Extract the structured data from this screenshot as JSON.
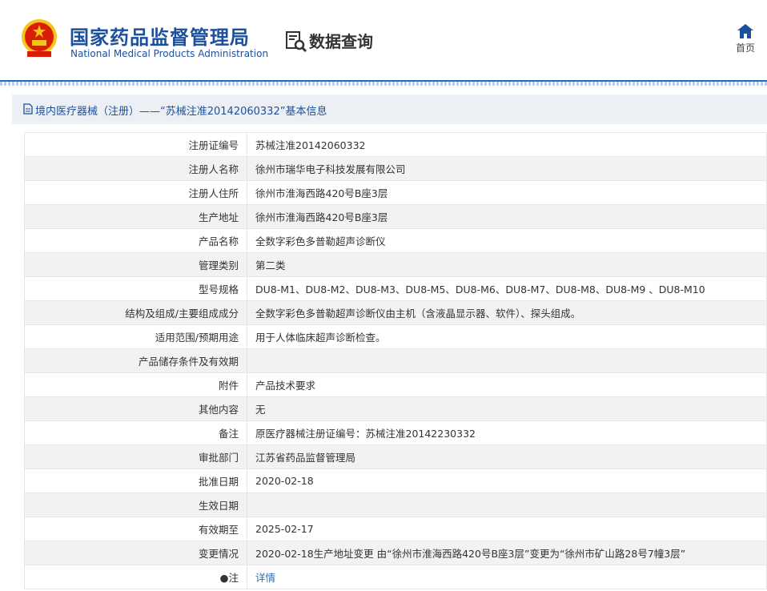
{
  "header": {
    "site_title": "国家药品监督管理局",
    "site_subtitle": "National Medical Products Administration",
    "query_title": "数据查询",
    "home_label": "首页"
  },
  "breadcrumb": {
    "text": "境内医疗器械（注册）——“苏械注准20142060332”基本信息"
  },
  "rows": [
    {
      "label": "注册证编号",
      "value": "苏械注准20142060332"
    },
    {
      "label": "注册人名称",
      "value": "徐州市瑞华电子科技发展有限公司"
    },
    {
      "label": "注册人住所",
      "value": "徐州市淮海西路420号B座3层"
    },
    {
      "label": "生产地址",
      "value": "徐州市淮海西路420号B座3层"
    },
    {
      "label": "产品名称",
      "value": "全数字彩色多普勒超声诊断仪"
    },
    {
      "label": "管理类别",
      "value": "第二类"
    },
    {
      "label": "型号规格",
      "value": "DU8-M1、DU8-M2、DU8-M3、DU8-M5、DU8-M6、DU8-M7、DU8-M8、DU8-M9 、DU8-M10"
    },
    {
      "label": "结构及组成/主要组成成分",
      "value": "全数字彩色多普勒超声诊断仪由主机（含液晶显示器、软件）、探头组成。"
    },
    {
      "label": "适用范围/预期用途",
      "value": "用于人体临床超声诊断检查。"
    },
    {
      "label": "产品储存条件及有效期",
      "value": ""
    },
    {
      "label": "附件",
      "value": "产品技术要求"
    },
    {
      "label": "其他内容",
      "value": "无"
    },
    {
      "label": "备注",
      "value": "原医疗器械注册证编号：苏械注准20142230332"
    },
    {
      "label": "审批部门",
      "value": "江苏省药品监督管理局"
    },
    {
      "label": "批准日期",
      "value": "2020-02-18"
    },
    {
      "label": "生效日期",
      "value": ""
    },
    {
      "label": "有效期至",
      "value": "2025-02-17"
    },
    {
      "label": "变更情况",
      "value": "2020-02-18生产地址变更 由“徐州市淮海西路420号B座3层”变更为“徐州市矿山路28号7幢3层”"
    },
    {
      "label": "●注",
      "value": "详情"
    }
  ],
  "colors": {
    "brand_blue": "#1c4f9c",
    "link_blue": "#2a6fb8",
    "emblem_red": "#d81e06",
    "emblem_gold": "#f5c518"
  }
}
